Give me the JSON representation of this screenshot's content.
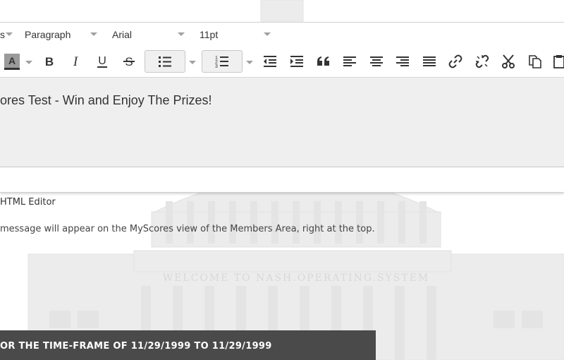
{
  "toolbar": {
    "formats_label": "s",
    "block_format": "Paragraph",
    "font_family": "Arial",
    "font_size": "11pt",
    "font_color_letter": "A",
    "bold_letter": "B",
    "italic_letter": "I",
    "underline_letter": "U",
    "strike_letter": "S",
    "icons": [
      "font-color-icon",
      "bold-icon",
      "italic-icon",
      "underline-icon",
      "strikethrough-icon",
      "bullet-list-icon",
      "numbered-list-icon",
      "outdent-icon",
      "indent-icon",
      "blockquote-icon",
      "align-left-icon",
      "align-center-icon",
      "align-right-icon",
      "justify-icon",
      "link-icon",
      "unlink-icon",
      "cut-icon",
      "copy-icon",
      "paste-icon"
    ]
  },
  "editor": {
    "content": "ores Test - Win and Enjoy The Prizes!"
  },
  "status": {
    "label": "HTML Editor"
  },
  "helper": {
    "text": "message will appear on the MyScores view of the Members Area, right at the top."
  },
  "banner": {
    "text": "OR THE TIME-FRAME OF 11/29/1999 TO 11/29/1999"
  },
  "watermark": {
    "text": "WELCOME TO NASH.OPERATING.SYSTEM"
  },
  "colors": {
    "banner_bg": "#4a4a4a",
    "content_bg": "#efefef",
    "icon": "#333333"
  }
}
